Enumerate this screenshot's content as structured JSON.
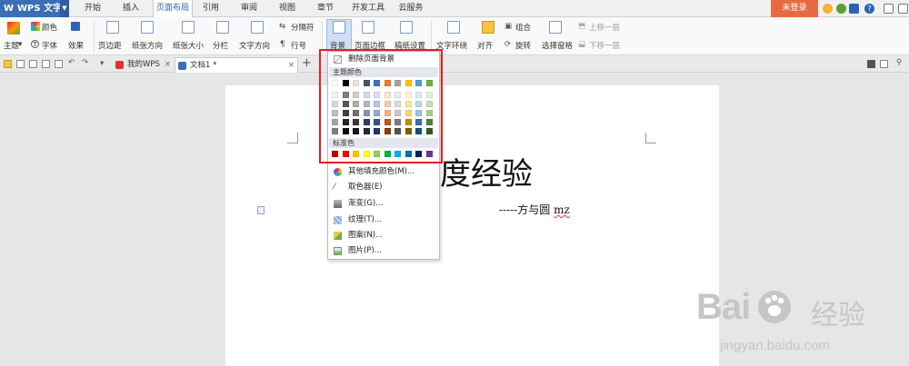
{
  "app": {
    "logo_label": "W",
    "name": "WPS 文字",
    "login_label": "未登录"
  },
  "menu": {
    "tabs": [
      "开始",
      "插入",
      "页面布局",
      "引用",
      "审阅",
      "视图",
      "章节",
      "开发工具",
      "云服务"
    ],
    "active_index": 2
  },
  "ribbon": {
    "theme_group": {
      "theme": "主题",
      "color": "颜色",
      "font": "字体",
      "effect": "效果"
    },
    "margins": "页边距",
    "orientation": "纸张方向",
    "size": "纸张大小",
    "columns": "分栏",
    "text_direction": "文字方向",
    "separator": "分隔符",
    "line_numbers": "行号",
    "background": "背景",
    "page_border": "页面边框",
    "draft_settings": "稿纸设置",
    "text_wrap": "文字环绕",
    "align": "对齐",
    "group": "组合",
    "rotate": "旋转",
    "selection_pane": "选择窗格",
    "bring_forward": "上移一层",
    "send_backward": "下移一层"
  },
  "tabs": {
    "items": [
      "我的WPS",
      "文档1 *"
    ],
    "active_index": 1,
    "close_symbol": "×",
    "add_symbol": "+"
  },
  "document": {
    "title": "度经验",
    "author_prefix": "-----方与圆 ",
    "author_suffix": "mz"
  },
  "background_menu": {
    "remove_label": "删除页面背景",
    "theme_colors_label": "主题颜色",
    "standard_colors_label": "标准色",
    "more_fill_label": "其他填充颜色(M)...",
    "eyedropper_label": "取色器(E)",
    "gradient_label": "渐变(G)...",
    "texture_label": "纹理(T)...",
    "pattern_label": "图案(N)...",
    "picture_label": "图片(P)...",
    "theme_top_row": [
      "#ffffff",
      "#000000",
      "#e7e6e6",
      "#44546a",
      "#4472c4",
      "#ed7d31",
      "#a5a5a5",
      "#ffc000",
      "#5b9bd5",
      "#70ad47"
    ],
    "theme_shades": [
      [
        "#f2f2f2",
        "#7f7f7f",
        "#d0cece",
        "#d6dce4",
        "#d9e2f3",
        "#fbe5d5",
        "#ededed",
        "#fff2cc",
        "#deebf6",
        "#e2efd9"
      ],
      [
        "#d8d8d8",
        "#595959",
        "#aeabab",
        "#adb9ca",
        "#b4c6e7",
        "#f7cbac",
        "#dbdbdb",
        "#fee599",
        "#bdd7ee",
        "#c5e0b3"
      ],
      [
        "#bfbfbf",
        "#3f3f3f",
        "#757070",
        "#8496b0",
        "#8eaadb",
        "#f4b183",
        "#c9c9c9",
        "#ffd965",
        "#9cc3e5",
        "#a8d08d"
      ],
      [
        "#a5a5a5",
        "#262626",
        "#3a3838",
        "#323f4f",
        "#2f5496",
        "#c55a11",
        "#7b7b7b",
        "#bf9000",
        "#2e75b5",
        "#538135"
      ],
      [
        "#7f7f7f",
        "#0c0c0c",
        "#171616",
        "#222a35",
        "#1f3864",
        "#833c0b",
        "#525252",
        "#7f6000",
        "#1e4e79",
        "#375623"
      ]
    ],
    "standard": [
      "#c00000",
      "#ff0000",
      "#ffc000",
      "#ffff00",
      "#92d050",
      "#00b050",
      "#00b0f0",
      "#0070c0",
      "#002060",
      "#7030a0"
    ]
  },
  "watermark": {
    "brand": "Bai",
    "brand_suffix": "经验",
    "url": "jingyan.baidu.com"
  },
  "colors": {
    "accent": "#2c64b3",
    "login": "#e86a43",
    "highlight": "#e02020"
  }
}
